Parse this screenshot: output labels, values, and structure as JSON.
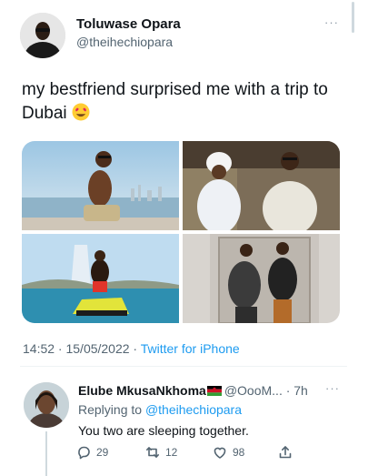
{
  "tweet": {
    "author_name": "Toluwase Opara",
    "author_handle": "@theihechiopara",
    "more_label": "···",
    "text": "my bestfriend surprised me with a trip to Dubai",
    "emoji_icon": "heart-eyes-emoji-icon",
    "timestamp": "14:52 · 15/05/2022 · ",
    "source": "Twitter for iPhone"
  },
  "reply": {
    "author_name": "Elube MkusaNkhoma",
    "flag_icon": "malawi-flag-icon",
    "handle_and_time": "@OooM... · 7h",
    "more_label": "···",
    "replying_prefix": "Replying to ",
    "replying_mention": "@theihechiopara",
    "text": "You two are sleeping together.",
    "actions": {
      "reply_count": "29",
      "retweet_count": "12",
      "like_count": "98"
    }
  },
  "colors": {
    "link": "#1d9bf0",
    "secondary_text": "#536471",
    "primary_text": "#0f1419"
  }
}
